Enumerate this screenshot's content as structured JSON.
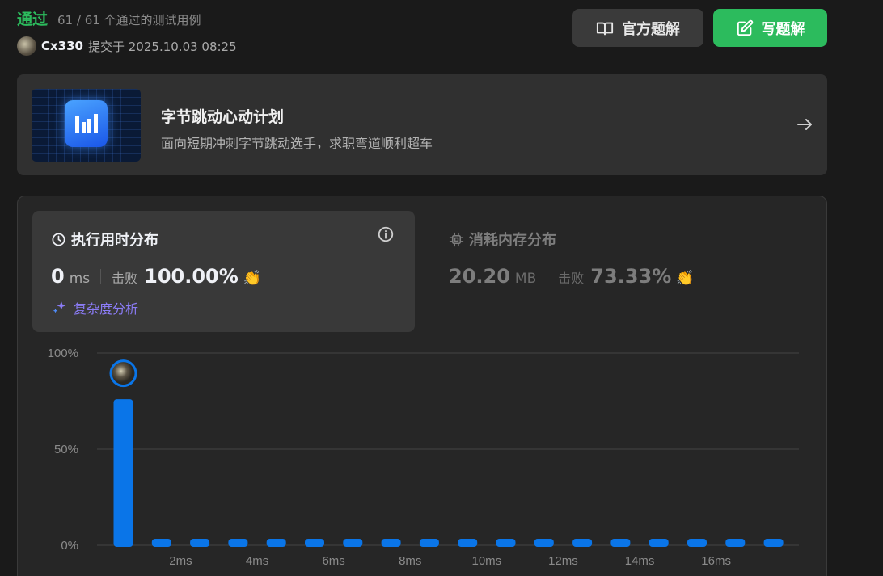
{
  "status": {
    "title": "通过",
    "subtitle": "61 / 61 个通过的测试用例"
  },
  "submission": {
    "username": "Cx330",
    "meta": "提交于 2025.10.03 08:25"
  },
  "buttons": {
    "official_solution": "官方题解",
    "write_solution": "写题解"
  },
  "banner": {
    "title": "字节跳动心动计划",
    "subtitle": "面向短期冲刺字节跳动选手，求职弯道顺利超车"
  },
  "runtime": {
    "heading": "执行用时分布",
    "value": "0",
    "unit": "ms",
    "beat_label": "击败",
    "beat_value": "100.00%",
    "analysis": "复杂度分析"
  },
  "memory": {
    "heading": "消耗内存分布",
    "value": "20.20",
    "unit": "MB",
    "beat_label": "击败",
    "beat_value": "73.33%"
  },
  "colors": {
    "accent_green": "#2cbb5d",
    "bar_blue": "#0a75e8",
    "purple": "#8b7cf6"
  },
  "chart_data": {
    "type": "bar",
    "x": [
      0,
      1,
      2,
      3,
      4,
      5,
      6,
      7,
      8,
      9,
      10,
      11,
      12,
      13,
      14,
      15,
      16,
      17
    ],
    "values": [
      76,
      1,
      1,
      1,
      1,
      1,
      1,
      1,
      1,
      1,
      1,
      1,
      1,
      1,
      1,
      1,
      1,
      1
    ],
    "ylim": [
      0,
      100
    ],
    "ytick_labels": [
      "100%",
      "50%",
      "0%"
    ],
    "xtick_labels": [
      "2ms",
      "4ms",
      "6ms",
      "8ms",
      "10ms",
      "12ms",
      "14ms",
      "16ms"
    ],
    "highlight_index": 0,
    "grid": true
  }
}
